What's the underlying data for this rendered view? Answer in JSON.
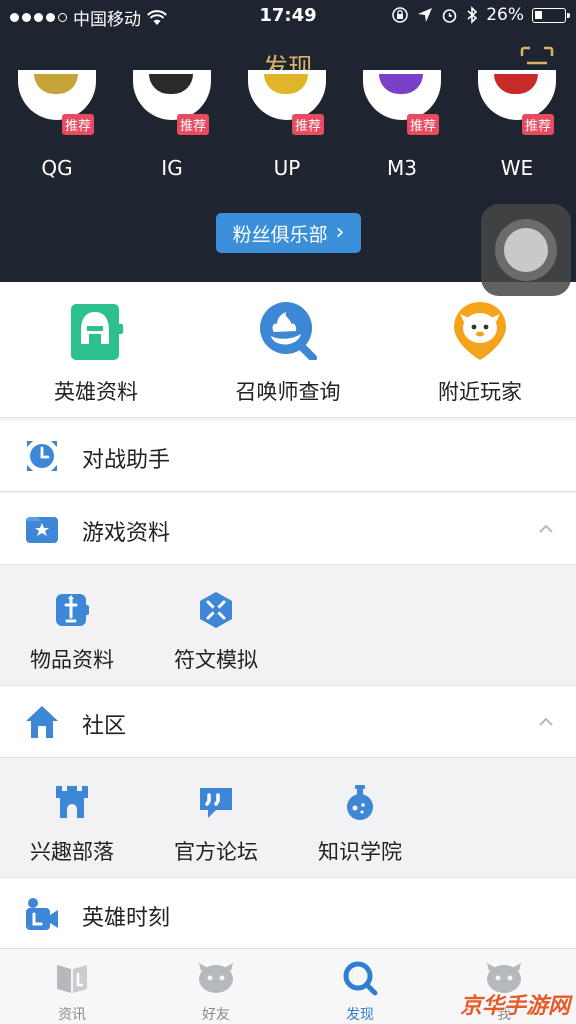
{
  "status_bar": {
    "carrier": "中国移动",
    "time": "17:49",
    "battery": "26%",
    "battery_level": 0.26
  },
  "header": {
    "title": "发现"
  },
  "teams": [
    {
      "name": "QG",
      "badge": "推荐",
      "color": "#c7a43a"
    },
    {
      "name": "IG",
      "badge": "推荐",
      "color": "#2a2a2a"
    },
    {
      "name": "UP",
      "badge": "推荐",
      "color": "#e1b52a"
    },
    {
      "name": "M3",
      "badge": "推荐",
      "color": "#7a40c8"
    },
    {
      "name": "WE",
      "badge": "推荐",
      "color": "#c82a2a"
    }
  ],
  "fans_club": {
    "label": "粉丝俱乐部",
    "chevron": "›"
  },
  "quick_links": [
    {
      "label": "英雄资料",
      "icon": "hero-helmet-icon"
    },
    {
      "label": "召唤师查询",
      "icon": "summoner-search-icon"
    },
    {
      "label": "附近玩家",
      "icon": "nearby-player-icon"
    }
  ],
  "menu": {
    "battle_assistant": "对战助手",
    "game_data": "游戏资料",
    "community": "社区",
    "hero_moments": "英雄时刻"
  },
  "game_data_items": [
    {
      "label": "物品资料",
      "icon": "item-icon"
    },
    {
      "label": "符文模拟",
      "icon": "rune-icon"
    }
  ],
  "community_items": [
    {
      "label": "兴趣部落",
      "icon": "tribe-icon"
    },
    {
      "label": "官方论坛",
      "icon": "forum-icon"
    },
    {
      "label": "知识学院",
      "icon": "academy-icon"
    }
  ],
  "tabs": [
    {
      "label": "资讯",
      "icon": "news-icon",
      "active": false
    },
    {
      "label": "好友",
      "icon": "friends-icon",
      "active": false
    },
    {
      "label": "发现",
      "icon": "discover-icon",
      "active": true
    },
    {
      "label": "我",
      "icon": "me-icon",
      "active": false
    }
  ],
  "watermark": "京华手游网",
  "colors": {
    "header_bg": "#1f2530",
    "accent_gold": "#d6b26a",
    "accent_blue": "#3b8fd8",
    "badge_red": "#e84a5f"
  }
}
